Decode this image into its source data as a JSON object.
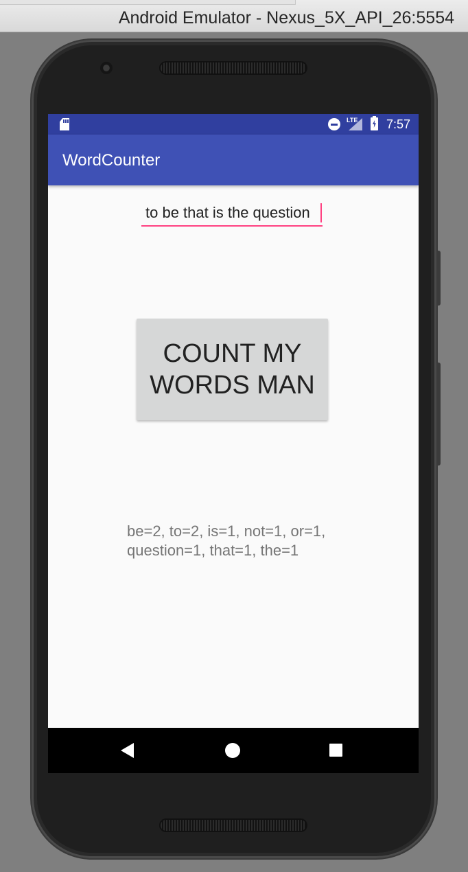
{
  "window": {
    "title": "Android Emulator - Nexus_5X_API_26:5554"
  },
  "status_bar": {
    "time": "7:57",
    "network_label": "LTE",
    "icons": [
      "sd-card-icon",
      "do-not-disturb-icon",
      "signal-icon",
      "battery-charging-icon"
    ],
    "color": "#303f9f"
  },
  "app_bar": {
    "title": "WordCounter",
    "color": "#3f51b5"
  },
  "input": {
    "value": "to be that is the question",
    "accent_color": "#ff4081"
  },
  "button": {
    "line1": "COUNT MY",
    "line2": "WORDS MAN"
  },
  "result": {
    "line1": "be=2, to=2, is=1, not=1, or=1,",
    "line2": "question=1, that=1, the=1"
  },
  "nav_bar": {
    "icons": [
      "back-icon",
      "home-icon",
      "recents-icon"
    ]
  }
}
